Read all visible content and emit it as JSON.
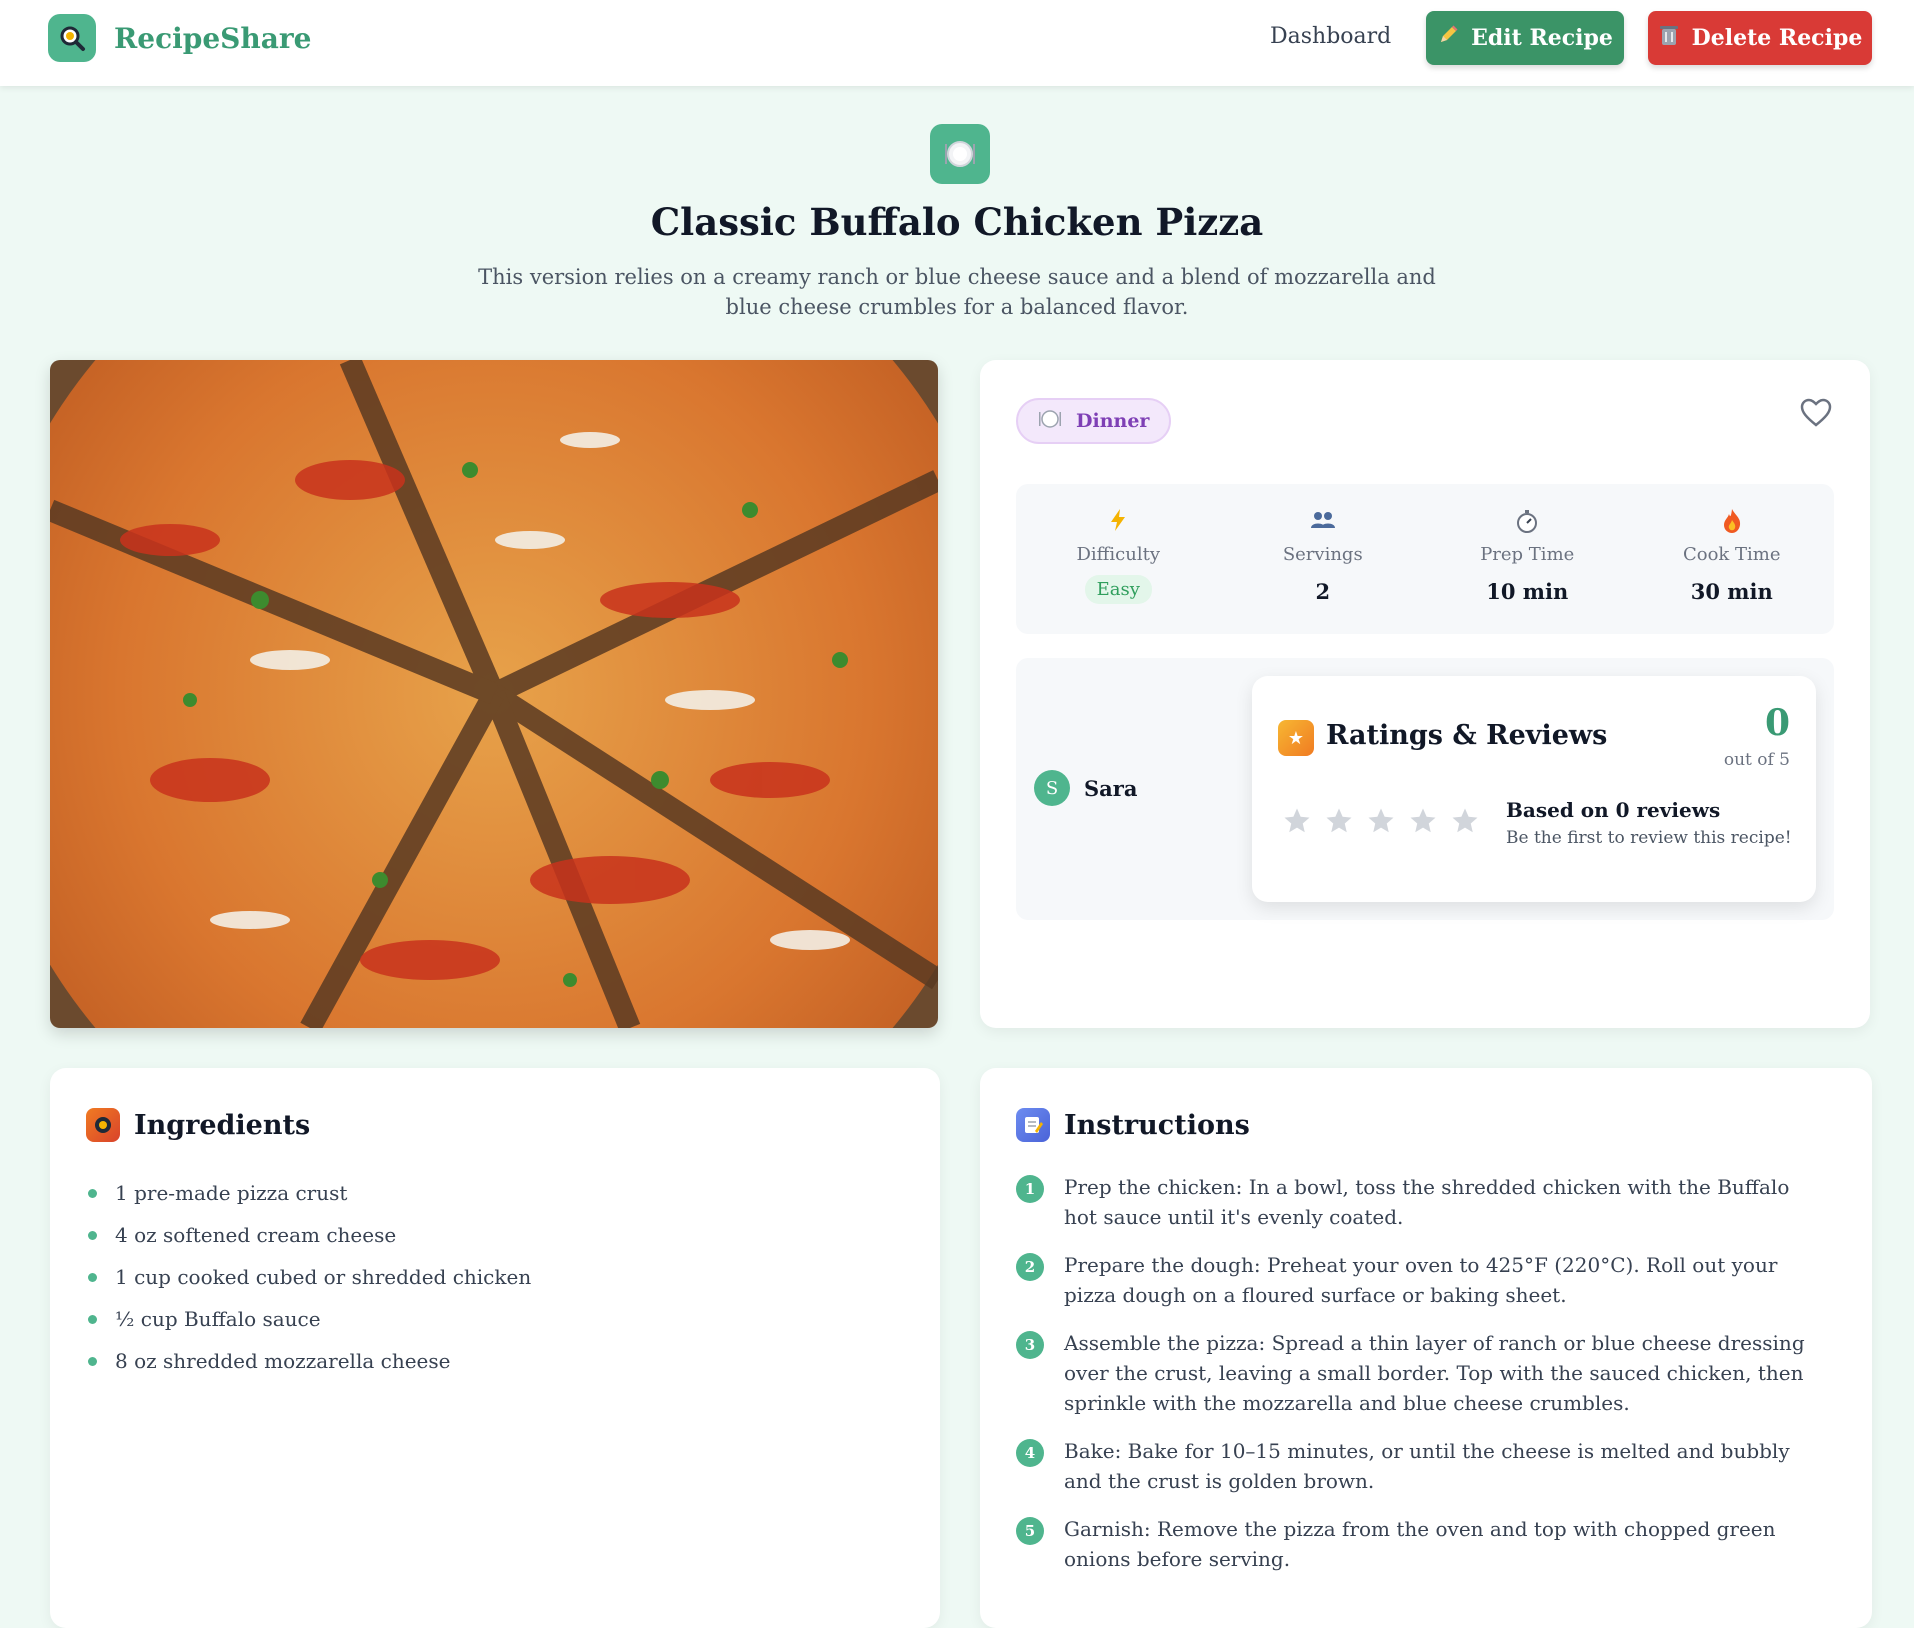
{
  "header": {
    "brand": "RecipeShare",
    "nav_dashboard": "Dashboard",
    "edit_label": "Edit Recipe",
    "delete_label": "Delete Recipe",
    "edit_icon": "pencil-icon",
    "delete_icon": "trash-icon"
  },
  "recipe": {
    "title": "Classic Buffalo Chicken Pizza",
    "description": "This version relies on a creamy ranch or blue cheese sauce and a blend of mozzarella and blue cheese crumbles for a balanced flavor.",
    "category": "Dinner",
    "stats": {
      "difficulty_label": "Difficulty",
      "difficulty_value": "Easy",
      "servings_label": "Servings",
      "servings_value": "2",
      "prep_label": "Prep Time",
      "prep_value": "10 min",
      "cook_label": "Cook Time",
      "cook_value": "30 min"
    },
    "author": {
      "initial": "S",
      "name": "Sara"
    }
  },
  "ratings": {
    "title": "Ratings & Reviews",
    "score": "0",
    "out_of": "out of 5",
    "stars_filled": 0,
    "stars_total": 5,
    "based_on": "Based on 0 reviews",
    "first_prompt": "Be the first to review this recipe!"
  },
  "ingredients": {
    "title": "Ingredients",
    "items": [
      "1 pre-made pizza crust",
      "4 oz softened cream cheese",
      "1 cup cooked cubed or shredded chicken",
      "½ cup Buffalo sauce",
      "8 oz shredded mozzarella cheese"
    ]
  },
  "instructions": {
    "title": "Instructions",
    "steps": [
      {
        "num": "1",
        "text": "Prep the chicken: In a bowl, toss the shredded chicken with the Buffalo hot sauce until it's evenly coated."
      },
      {
        "num": "2",
        "text": "Prepare the dough: Preheat your oven to 425°F (220°C). Roll out your pizza dough on a floured surface or baking sheet."
      },
      {
        "num": "3",
        "text": "Assemble the pizza: Spread a thin layer of ranch or blue cheese dressing over the crust, leaving a small border. Top with the sauced chicken, then sprinkle with the mozzarella and blue cheese crumbles."
      },
      {
        "num": "4",
        "text": "Bake: Bake for 10–15 minutes, or until the cheese is melted and bubbly and the crust is golden brown."
      },
      {
        "num": "5",
        "text": "Garnish: Remove the pizza from the oven and top with chopped green onions before serving."
      }
    ]
  },
  "colors": {
    "brand": "#3a9a74",
    "accent": "#4fb58e",
    "edit_button": "#3b9467",
    "delete_button": "#d93a36",
    "page_bg": "#eef9f4"
  }
}
